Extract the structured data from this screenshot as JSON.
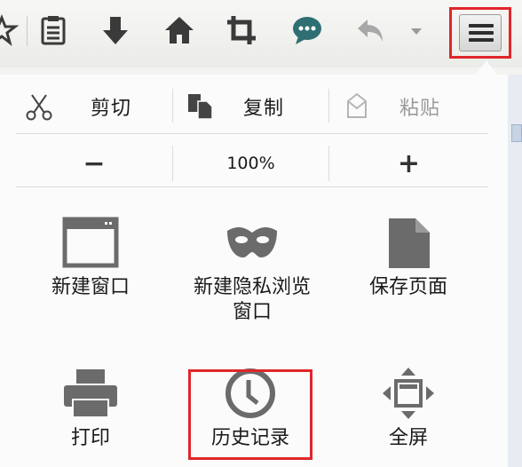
{
  "menu": {
    "edit": {
      "cut": "剪切",
      "copy": "复制",
      "paste": "粘贴"
    },
    "zoom": {
      "out": "−",
      "level": "100%",
      "in": "+"
    },
    "items": [
      {
        "label": "新建窗口"
      },
      {
        "label": "新建隐私浏览窗口"
      },
      {
        "label": "保存页面"
      },
      {
        "label": "打印"
      },
      {
        "label": "历史记录"
      },
      {
        "label": "全屏"
      }
    ]
  },
  "colors": {
    "highlight": "#e0262a",
    "icon": "#6b6b6b",
    "toolbar_icon": "#3a3a3a"
  },
  "icons": {
    "toolbar": [
      "star-icon",
      "reading-list-icon",
      "download-icon",
      "home-icon",
      "crop-icon",
      "chat-icon",
      "undo-icon",
      "dropdown-icon",
      "menu-icon"
    ]
  }
}
